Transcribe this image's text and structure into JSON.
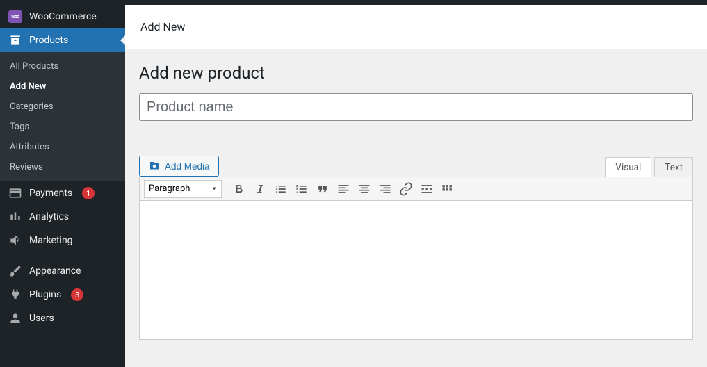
{
  "sidebar": {
    "woocommerce_label": "WooCommerce",
    "products_label": "Products",
    "submenu": {
      "all": "All Products",
      "add_new": "Add New",
      "categories": "Categories",
      "tags": "Tags",
      "attributes": "Attributes",
      "reviews": "Reviews"
    },
    "payments_label": "Payments",
    "payments_badge": "1",
    "analytics_label": "Analytics",
    "marketing_label": "Marketing",
    "appearance_label": "Appearance",
    "plugins_label": "Plugins",
    "plugins_badge": "3",
    "users_label": "Users"
  },
  "header": {
    "title": "Add New"
  },
  "page": {
    "title": "Add new product",
    "product_name_placeholder": "Product name"
  },
  "editor": {
    "add_media_label": "Add Media",
    "tabs": {
      "visual": "Visual",
      "text": "Text"
    },
    "format_selector": "Paragraph"
  }
}
